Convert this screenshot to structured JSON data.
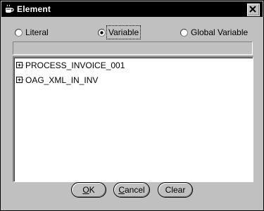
{
  "window": {
    "title": "Element",
    "title_icon": "app-cup-icon",
    "close_icon": "close-icon"
  },
  "radios": [
    {
      "label": "Literal",
      "selected": false
    },
    {
      "label": "Variable",
      "selected": true
    },
    {
      "label": "Global Variable",
      "selected": false
    }
  ],
  "field": {
    "value": ""
  },
  "tree": {
    "items": [
      {
        "label": "PROCESS_INVOICE_001",
        "expander": "plus-icon"
      },
      {
        "label": "OAG_XML_IN_INV",
        "expander": "plus-icon"
      }
    ]
  },
  "buttons": {
    "ok": {
      "mnemonic": "O",
      "rest": "K"
    },
    "cancel": {
      "mnemonic": "C",
      "rest": "ancel"
    },
    "clear": {
      "label": "Clear"
    }
  },
  "colors": {
    "face": "#c0c0c0",
    "titlebar": "#000000",
    "tree_bg": "#ffffff"
  }
}
